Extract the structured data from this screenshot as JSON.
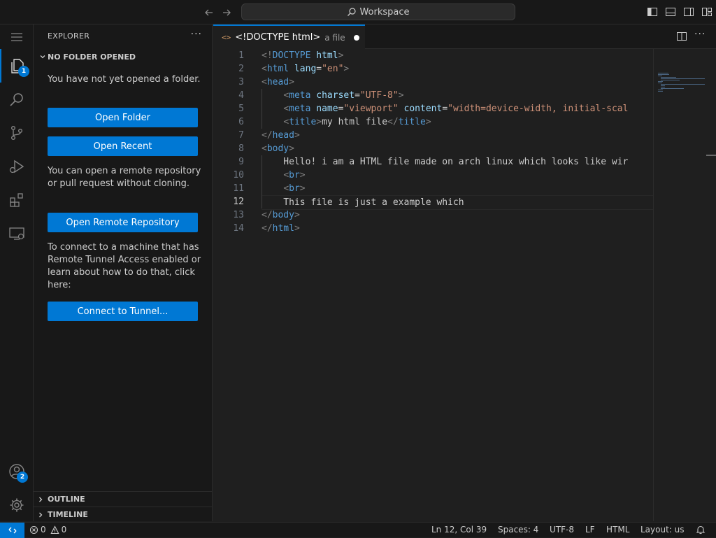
{
  "titlebar": {
    "search_label": "Workspace"
  },
  "activitybar": {
    "explorer_badge": "1",
    "accounts_badge": "2"
  },
  "sidebar": {
    "header": "EXPLORER",
    "more": "···",
    "section_title": "NO FOLDER OPENED",
    "msg_no_folder": "You have not yet opened a folder.",
    "btn_open_folder": "Open Folder",
    "btn_open_recent": "Open Recent",
    "msg_remote": "You can open a remote repository or pull request without cloning.",
    "btn_open_remote": "Open Remote Repository",
    "msg_tunnel": "To connect to a machine that has Remote Tunnel Access enabled or learn about how to do that, click here:",
    "btn_tunnel": "Connect to Tunnel...",
    "outline": "OUTLINE",
    "timeline": "TIMELINE"
  },
  "editor": {
    "tab_icon": "<>",
    "tab_name": "<!DOCTYPE html>",
    "tab_desc": "a file",
    "current_line": 12,
    "lines": [
      [
        [
          "t-br",
          "<!"
        ],
        [
          "t-doc",
          "DOCTYPE"
        ],
        [
          "t-txt",
          " "
        ],
        [
          "t-attr",
          "html"
        ],
        [
          "t-br",
          ">"
        ]
      ],
      [
        [
          "t-br",
          "<"
        ],
        [
          "t-tag",
          "html"
        ],
        [
          "t-txt",
          " "
        ],
        [
          "t-attr",
          "lang"
        ],
        [
          "t-txt",
          "="
        ],
        [
          "t-str",
          "\"en\""
        ],
        [
          "t-br",
          ">"
        ]
      ],
      [
        [
          "t-br",
          "<"
        ],
        [
          "t-tag",
          "head"
        ],
        [
          "t-br",
          ">"
        ]
      ],
      [
        [
          "t-txt",
          "    "
        ],
        [
          "t-br",
          "<"
        ],
        [
          "t-tag",
          "meta"
        ],
        [
          "t-txt",
          " "
        ],
        [
          "t-attr",
          "charset"
        ],
        [
          "t-txt",
          "="
        ],
        [
          "t-str",
          "\"UTF-8\""
        ],
        [
          "t-br",
          ">"
        ]
      ],
      [
        [
          "t-txt",
          "    "
        ],
        [
          "t-br",
          "<"
        ],
        [
          "t-tag",
          "meta"
        ],
        [
          "t-txt",
          " "
        ],
        [
          "t-attr",
          "name"
        ],
        [
          "t-txt",
          "="
        ],
        [
          "t-str",
          "\"viewport\""
        ],
        [
          "t-txt",
          " "
        ],
        [
          "t-attr",
          "content"
        ],
        [
          "t-txt",
          "="
        ],
        [
          "t-str",
          "\"width=device-width, initial-scal"
        ]
      ],
      [
        [
          "t-txt",
          "    "
        ],
        [
          "t-br",
          "<"
        ],
        [
          "t-tag",
          "title"
        ],
        [
          "t-br",
          ">"
        ],
        [
          "t-txt",
          "my html file"
        ],
        [
          "t-br",
          "</"
        ],
        [
          "t-tag",
          "title"
        ],
        [
          "t-br",
          ">"
        ]
      ],
      [
        [
          "t-br",
          "</"
        ],
        [
          "t-tag",
          "head"
        ],
        [
          "t-br",
          ">"
        ]
      ],
      [
        [
          "t-br",
          "<"
        ],
        [
          "t-tag",
          "body"
        ],
        [
          "t-br",
          ">"
        ]
      ],
      [
        [
          "t-txt",
          "    Hello! i am a HTML file made on arch linux which looks like wir"
        ]
      ],
      [
        [
          "t-txt",
          "    "
        ],
        [
          "t-br",
          "<"
        ],
        [
          "t-tag",
          "br"
        ],
        [
          "t-br",
          ">"
        ]
      ],
      [
        [
          "t-txt",
          "    "
        ],
        [
          "t-br",
          "<"
        ],
        [
          "t-tag",
          "br"
        ],
        [
          "t-br",
          ">"
        ]
      ],
      [
        [
          "t-txt",
          "    This file is just a example which"
        ]
      ],
      [
        [
          "t-br",
          "</"
        ],
        [
          "t-tag",
          "body"
        ],
        [
          "t-br",
          ">"
        ]
      ],
      [
        [
          "t-br",
          "</"
        ],
        [
          "t-tag",
          "html"
        ],
        [
          "t-br",
          ">"
        ]
      ]
    ]
  },
  "statusbar": {
    "errors": "0",
    "warnings": "0",
    "position": "Ln 12, Col 39",
    "spaces": "Spaces: 4",
    "encoding": "UTF-8",
    "eol": "LF",
    "language": "HTML",
    "layout": "Layout: us"
  }
}
